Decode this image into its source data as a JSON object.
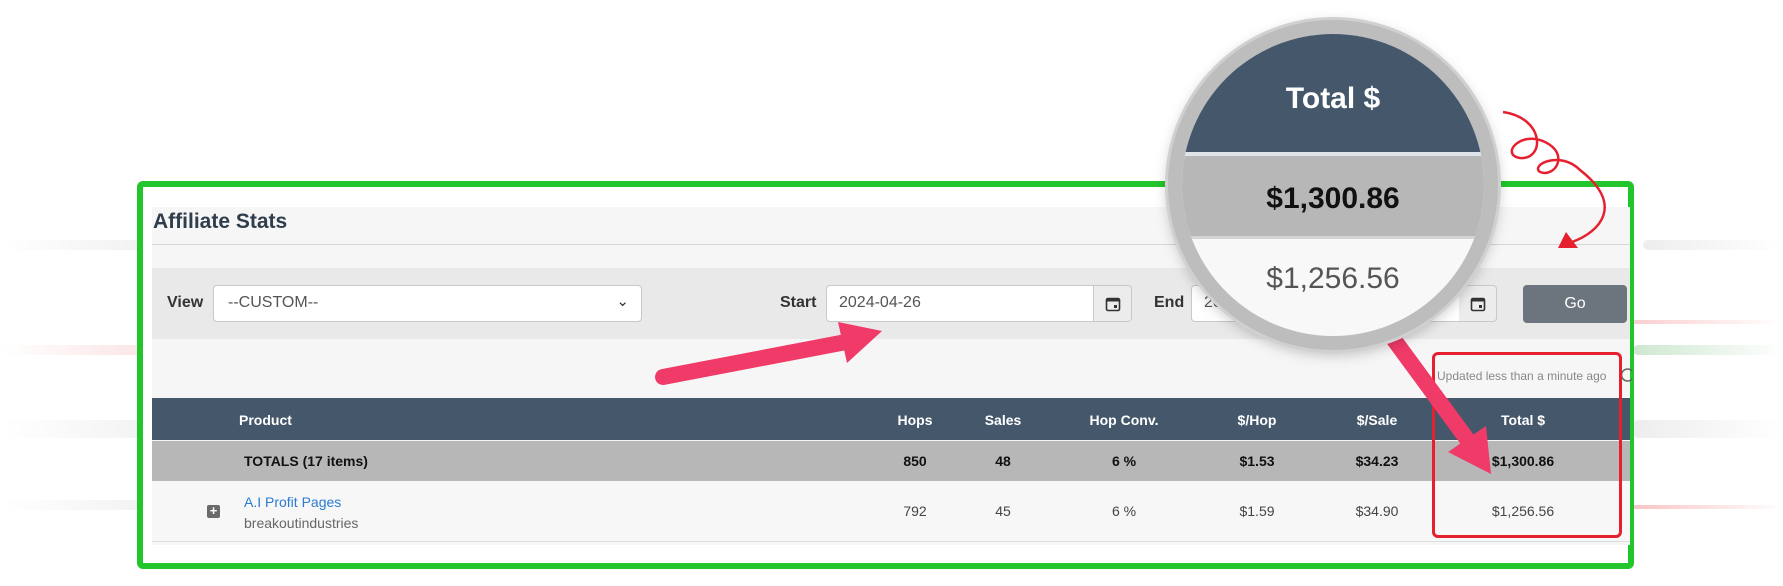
{
  "page": {
    "title": "Affiliate Stats"
  },
  "filters": {
    "view_label": "View",
    "view_value": "--CUSTOM--",
    "start_label": "Start",
    "start_value": "2024-04-26",
    "end_label": "End",
    "end_value_partial": "20",
    "go_label": "Go"
  },
  "status": {
    "updated": "Updated less than a minute ago"
  },
  "table": {
    "headers": {
      "product": "Product",
      "hops": "Hops",
      "sales": "Sales",
      "hop_conv": "Hop Conv.",
      "per_hop": "$/Hop",
      "per_sale": "$/Sale",
      "total": "Total $"
    },
    "totals": {
      "label": "TOTALS (17 items)",
      "hops": "850",
      "sales": "48",
      "hop_conv": "6 %",
      "per_hop": "$1.53",
      "per_sale": "$34.23",
      "total": "$1,300.86"
    },
    "rows": [
      {
        "product": "A.I Profit Pages",
        "vendor": "breakoutindustries",
        "hops": "792",
        "sales": "45",
        "hop_conv": "6 %",
        "per_hop": "$1.59",
        "per_sale": "$34.90",
        "total": "$1,256.56"
      }
    ]
  },
  "magnifier": {
    "header": "Total $",
    "totals_value": "$1,300.86",
    "row_value": "$1,256.56"
  },
  "colors": {
    "frame": "#22c52c",
    "highlight": "#e5202f",
    "arrow": "#f03a68",
    "table_header": "#45586b",
    "totals_row": "#b7b7b7",
    "button": "#6c757d",
    "link": "#2b7bd1"
  },
  "icons": {
    "calendar": "calendar-icon",
    "expand": "plus-square-icon",
    "dropdown": "chevron-down-icon",
    "refresh": "refresh-icon"
  }
}
